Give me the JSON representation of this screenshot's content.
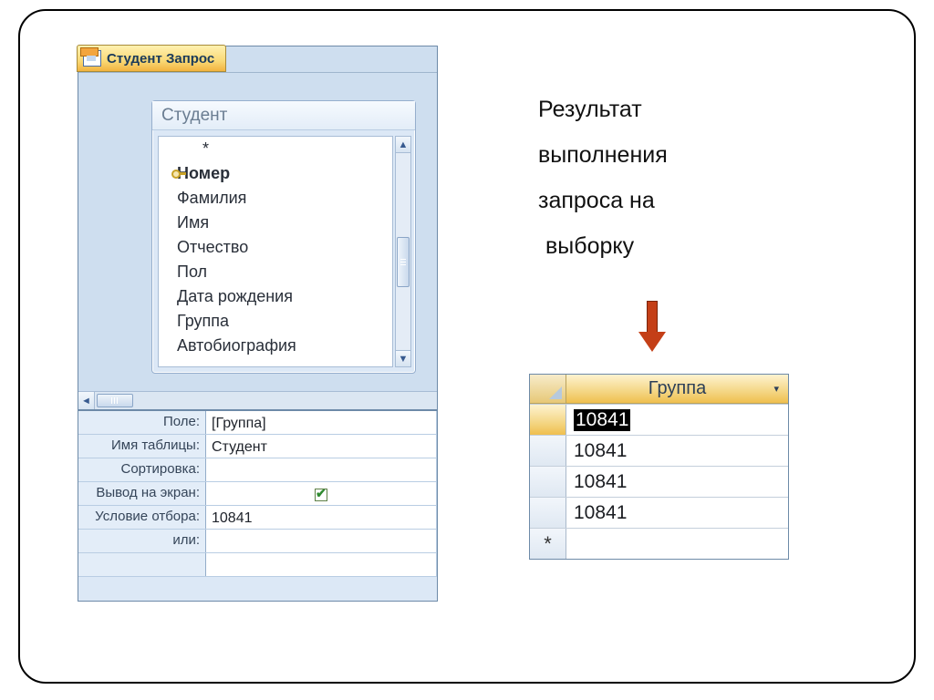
{
  "tab_title": "Студент Запрос",
  "table": {
    "name": "Студент",
    "fields": [
      "*",
      "Номер",
      "Фамилия",
      "Имя",
      "Отчество",
      "Пол",
      "Дата рождения",
      "Группа",
      "Автобиография"
    ],
    "pk_index": 1
  },
  "grid": {
    "labels": {
      "field": "Поле:",
      "table": "Имя таблицы:",
      "sort": "Сортировка:",
      "show": "Вывод на экран:",
      "criteria": "Условие отбора:",
      "or": "или:"
    },
    "col1": {
      "field": "[Группа]",
      "table": "Студент",
      "sort": "",
      "show": true,
      "criteria": "10841",
      "or": ""
    }
  },
  "annotation": {
    "line1": "Результат",
    "line2": "выполнения",
    "line3": "запроса на",
    "line4": "выборку"
  },
  "result": {
    "column": "Группа",
    "rows": [
      "10841",
      "10841",
      "10841",
      "10841"
    ],
    "new_row_marker": "*"
  }
}
